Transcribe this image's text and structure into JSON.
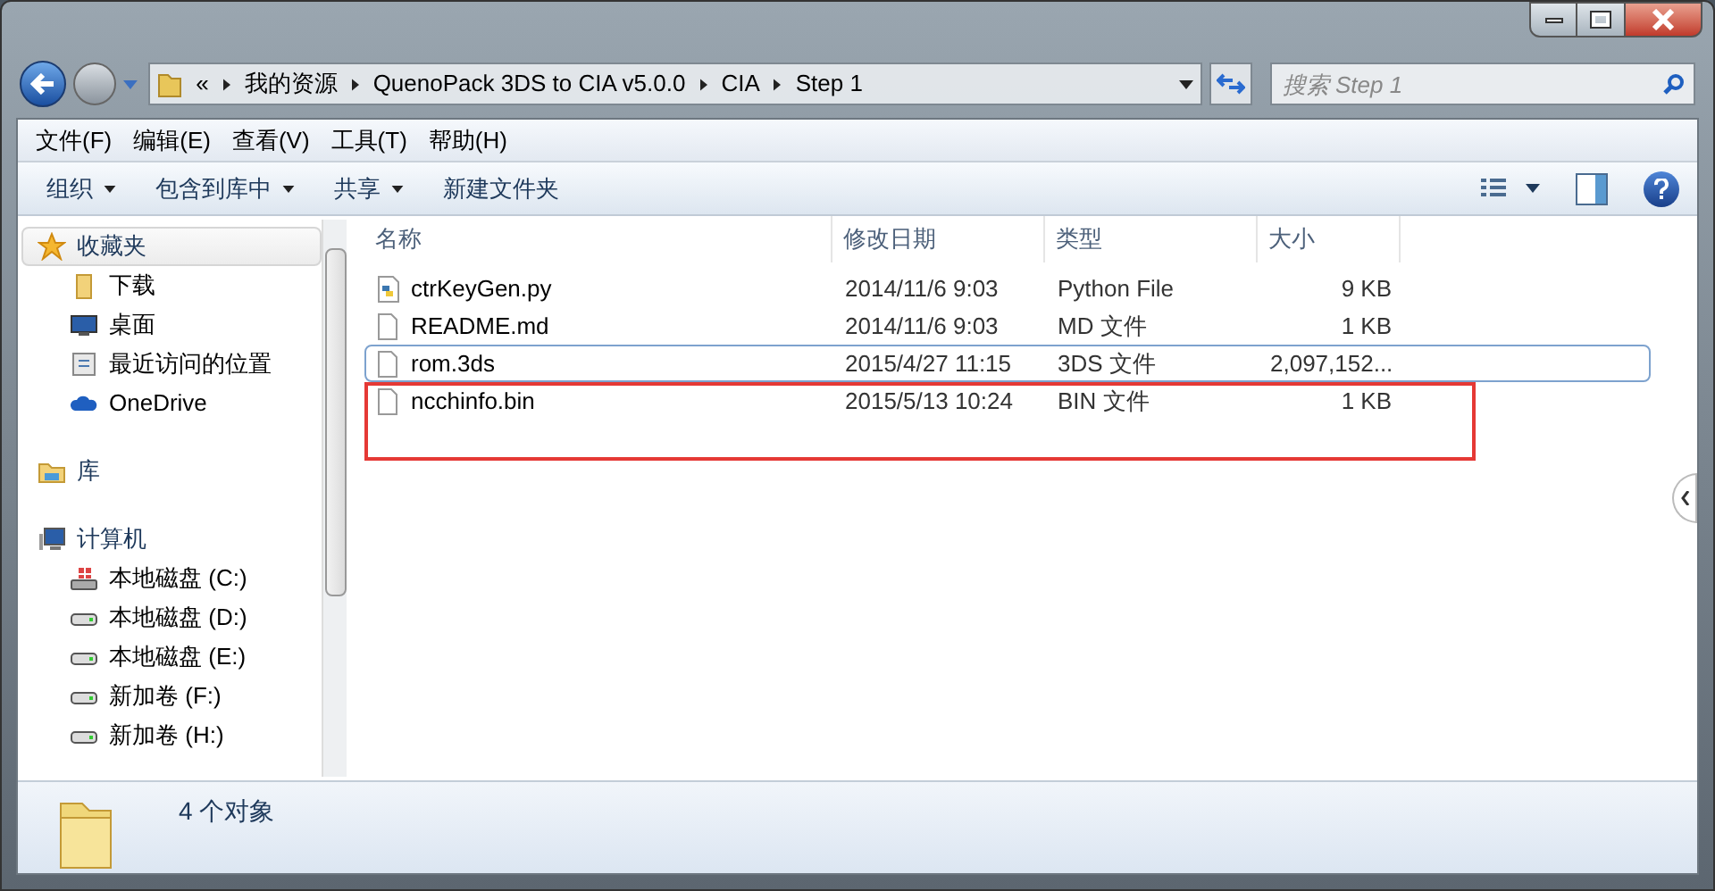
{
  "address_bar": {
    "overflow": "«",
    "crumbs": [
      "我的资源",
      "QuenoPack 3DS to CIA v5.0.0",
      "CIA",
      "Step 1"
    ]
  },
  "search": {
    "placeholder": "搜索 Step 1"
  },
  "menu": [
    "文件(F)",
    "编辑(E)",
    "查看(V)",
    "工具(T)",
    "帮助(H)"
  ],
  "commands": [
    {
      "label": "组织",
      "dropdown": true
    },
    {
      "label": "包含到库中",
      "dropdown": true
    },
    {
      "label": "共享",
      "dropdown": true
    },
    {
      "label": "新建文件夹",
      "dropdown": false
    }
  ],
  "sidebar": [
    {
      "label": "收藏夹",
      "kind": "star",
      "selected": true,
      "children": [
        {
          "label": "下载",
          "kind": "folder",
          "selected": false
        },
        {
          "label": "桌面",
          "kind": "desktop",
          "selected": false
        },
        {
          "label": "最近访问的位置",
          "kind": "recent",
          "selected": false
        },
        {
          "label": "OneDrive",
          "kind": "cloud",
          "selected": false
        }
      ]
    },
    {
      "label": "库",
      "kind": "library",
      "selected": false
    },
    {
      "label": "计算机",
      "kind": "computer",
      "selected": false,
      "children": [
        {
          "label": "本地磁盘 (C:)",
          "kind": "sysdrive",
          "selected": false
        },
        {
          "label": "本地磁盘 (D:)",
          "kind": "drive",
          "selected": false
        },
        {
          "label": "本地磁盘 (E:)",
          "kind": "drive",
          "selected": false
        },
        {
          "label": "新加卷 (F:)",
          "kind": "drive",
          "selected": false
        },
        {
          "label": "新加卷 (H:)",
          "kind": "drive",
          "selected": false
        }
      ]
    }
  ],
  "table": {
    "columns": [
      "名称",
      "修改日期",
      "类型",
      "大小"
    ],
    "rows": [
      {
        "name": "ctrKeyGen.py",
        "kind": "python",
        "date": "2014/11/6 9:03",
        "type": "Python File",
        "size": "9 KB",
        "focused": false,
        "highlighted": false
      },
      {
        "name": "README.md",
        "kind": "file",
        "date": "2014/11/6 9:03",
        "type": "MD 文件",
        "size": "1 KB",
        "focused": false,
        "highlighted": false
      },
      {
        "name": "rom.3ds",
        "kind": "file",
        "date": "2015/4/27 11:15",
        "type": "3DS 文件",
        "size": "2,097,152...",
        "focused": true,
        "highlighted": false
      },
      {
        "name": "ncchinfo.bin",
        "kind": "file",
        "date": "2015/5/13 10:24",
        "type": "BIN 文件",
        "size": "1 KB",
        "focused": false,
        "highlighted": true
      }
    ]
  },
  "status": {
    "count": "4 个对象"
  }
}
